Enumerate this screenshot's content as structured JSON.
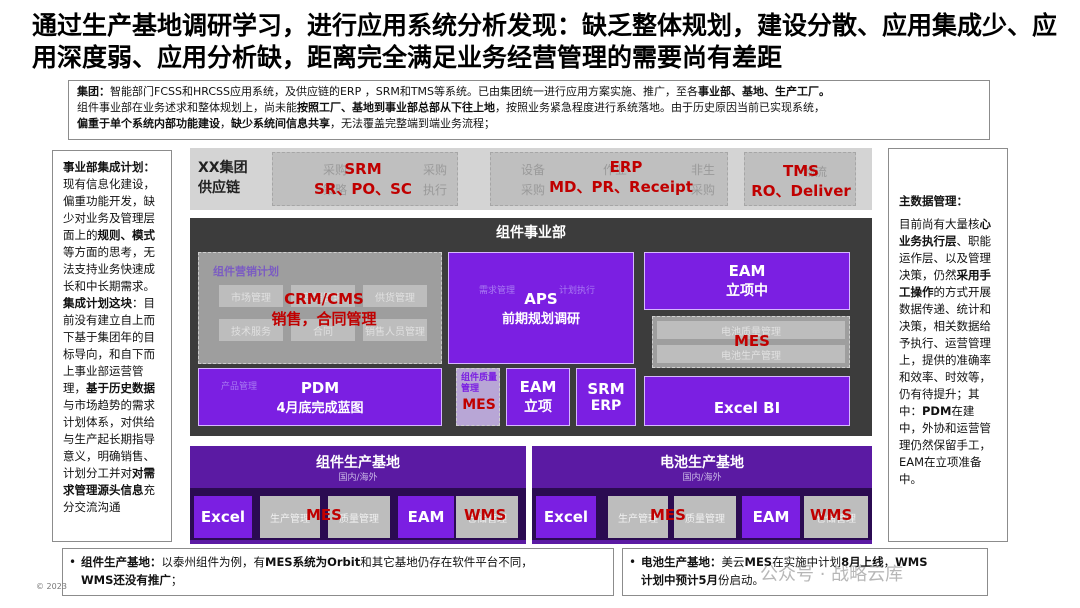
{
  "title": "通过生产基地调研学习，进行应用系统分析发现：缺乏整体规划，建设分散、应用集成少、应用深度弱、应用分析缺，距离完全满足业务经营管理的需要尚有差距",
  "group": {
    "l1_b1": "集团：",
    "l1_t1": "智能部门FCSS和HRCSS应用系统，及供应链的ERP ，SRM和TMS等系统。已由集团统一进行应用方案实施、推广，至各",
    "l1_b2": "事业部、基地、生产工厂。",
    "l2_t1": "组件事业部在业务述求和整体规划上，尚未能",
    "l2_b1": "按照工厂、基地到事业部总部从下往上地",
    "l2_t2": "，按照业务紧急程度进行系统落地。由于历史原因当前已实现系统，",
    "l3_b1": "偏重于单个系统内部功能建设",
    "l3_t1": "，",
    "l3_b2": "缺少系统间信息共享",
    "l3_t2": "，无法覆盖完整端到端业务流程；"
  },
  "left_panel": {
    "h1": "事业部集成计划：",
    "p1a": "现有信息化建设，偏重功能开发，缺少对业务及管理层面上的",
    "p1b": "规则、模式",
    "p1c": "等方面的思考，无法支持业务快速成长和中长期需求。",
    "h2": "集成计划这块",
    "p2a": "：目前没有建立自上而下基于集团年的目标导向，和自下而上事业部运营管理，",
    "p2b": "基于历史数据",
    "p2c": "与市场趋势的需求计划体系，对供给与生产起长期指导意义，明确销售、计划分工并对",
    "p2d": "对需求管理源头信息",
    "p2e": "充分交流沟通"
  },
  "right_panel": {
    "h1": "主数据管理：",
    "p1a": "目前尚有大量核",
    "p1b": "心业务执行层",
    "p1c": "、职能运作层、以及管理决策，仍然",
    "p1d": "采用手工操作",
    "p1e": "的方式开展数据传递、统计和决策，相关数据给予执行、运营管理上，提供的准确率和效率、时效等，仍有待提升；其中：",
    "p1f": "PDM",
    "p1g": "在建中，外协和运营管理仍然保留手工，EAM在立项准备中。"
  },
  "supply_chain": {
    "label": "XX集团供应链",
    "srm_faint": [
      "采购",
      "采购",
      "策略",
      "执行"
    ],
    "srm_title": "SRM",
    "srm_sub": "SR、PO、SC",
    "erp_faint": [
      "设备",
      "采购",
      "作业",
      "非生",
      "采购"
    ],
    "erp_title": "ERP",
    "erp_sub": "MD、PR、Receipt",
    "tms_faint": [
      "物流"
    ],
    "tms_title": "TMS",
    "tms_sub": "RO、Deliver"
  },
  "assembly": {
    "title": "组件事业部",
    "grey_header": "组件营销计划",
    "grey_cells": [
      "市场管理",
      "营销管理",
      "技术服务",
      "合同",
      "供货管理",
      "销售人员管理"
    ],
    "crm_title": "CRM/CMS",
    "crm_sub": "销售，合同管理",
    "aps_title": "APS",
    "aps_sub": "前期规划调研",
    "aps_faint": [
      "需求管理",
      "计划执行"
    ],
    "eam_title": "EAM",
    "eam_sub": "立项中",
    "mes_faint_1": "电池质量管理",
    "mes_title": "MES",
    "mes_faint_2": "电池生产管理",
    "pdm_title": "PDM",
    "pdm_sub": "4月底完成蓝图",
    "pdm_faint": "产品管理",
    "quality_faint": "组件质量管理",
    "quality_red": "MES",
    "eam_box_title": "EAM",
    "eam_box_sub": "立项",
    "srm_erp_1": "SRM",
    "srm_erp_2": "ERP",
    "excel_bi": "Excel BI"
  },
  "base_module": {
    "title": "组件生产基地",
    "sub": "国内/海外",
    "excel": "Excel",
    "grey1": "生产管理",
    "mes": "MES",
    "grey2": "质量管理",
    "eam": "EAM",
    "wms": "WMS",
    "grey3": "仓储管理"
  },
  "base_cell": {
    "title": "电池生产基地",
    "sub": "国内/海外",
    "excel": "Excel",
    "grey1": "生产管理",
    "mes": "MES",
    "grey2": "质量管理",
    "eam": "EAM",
    "wms": "WMS",
    "grey3": "仓储管理"
  },
  "notes": {
    "left_b1": "组件生产基地：",
    "left_t1": "以泰州组件为例，有",
    "left_b2": "MES系统为Orbit",
    "left_t2": "和其它基地仍存在软件平台不同，",
    "left_b3": "WMS还没有推广",
    "left_t3": "；",
    "right_b1": "电池生产基地：",
    "right_t1": "美云",
    "right_b2": "MES",
    "right_t2": "在实施中计划",
    "right_b3": "8月上线",
    "right_t3": "，",
    "right_b4": "WMS",
    "right_b5": "计划中预计5月",
    "right_t4": "份启动。"
  },
  "footer": "© 2023",
  "watermark": "公众号 · 战略云库",
  "colors": {
    "purple": "#7b1fe2",
    "dark_purple": "#5b1aa3",
    "red": "#c00000",
    "dark_grey": "#3c3c3c"
  }
}
